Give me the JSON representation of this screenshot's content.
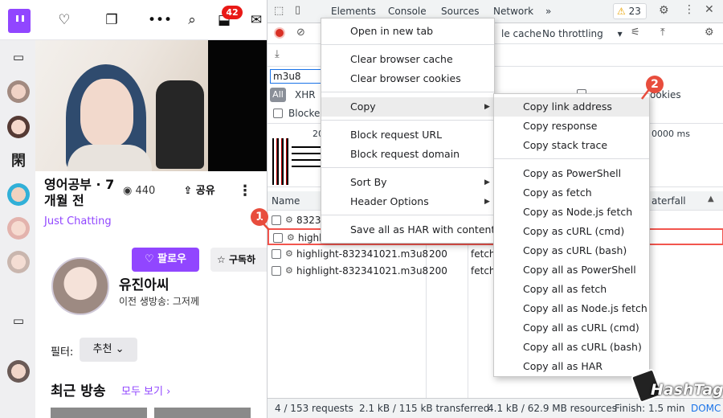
{
  "twitch": {
    "notification_count": "42",
    "stream_title": "영어공부 · 7개월 전",
    "viewers": "440",
    "share_label": "공유",
    "category": "Just Chatting",
    "follow_label": "팔로우",
    "subscribe_label": "구독하",
    "channel_name": "유진아씨",
    "last_stream": "이전 생방송: 그저께",
    "filter_label": "필터:",
    "filter_value": "추천",
    "recent_title": "최근 방송",
    "see_all": "모두 보기"
  },
  "devtools": {
    "tabs": [
      "Elements",
      "Console",
      "Sources",
      "Network"
    ],
    "warning_count": "23",
    "toolbar": {
      "disable_cache": "le cache",
      "throttling": "No throttling"
    },
    "filter_value": "m3u8",
    "types": {
      "all": "All",
      "xhr": "XHR"
    },
    "blocked_label": "Blocked",
    "cookies_label": "ookies",
    "timeline_ms": "0000 ms",
    "timeline_200": "20",
    "headers": {
      "name": "Name",
      "waterfall": "aterfall"
    },
    "rows": [
      {
        "name": "83234",
        "status": "",
        "type": ""
      },
      {
        "name": "highlig",
        "status": "",
        "type": ""
      },
      {
        "name": "highlight-832341021.m3u8",
        "status": "200",
        "type": "fetch"
      },
      {
        "name": "highlight-832341021.m3u8",
        "status": "200",
        "type": "fetch"
      }
    ],
    "status_bar": {
      "requests": "4 / 153 requests",
      "transferred": "2.1 kB / 115 kB transferred",
      "resources": "4.1 kB / 62.9 MB resources",
      "finish": "Finish: 1.5 min",
      "domc": "DOMC"
    }
  },
  "context_menu": {
    "items": [
      "Open in new tab",
      "Clear browser cache",
      "Clear browser cookies",
      "Copy",
      "Block request URL",
      "Block request domain",
      "Sort By",
      "Header Options",
      "Save all as HAR with content"
    ]
  },
  "copy_submenu": {
    "items": [
      "Copy link address",
      "Copy response",
      "Copy stack trace",
      "Copy as PowerShell",
      "Copy as fetch",
      "Copy as Node.js fetch",
      "Copy as cURL (cmd)",
      "Copy as cURL (bash)",
      "Copy all as PowerShell",
      "Copy all as fetch",
      "Copy all as Node.js fetch",
      "Copy all as cURL (cmd)",
      "Copy all as cURL (bash)",
      "Copy all as HAR"
    ]
  },
  "callouts": [
    "1",
    "2"
  ],
  "watermark": "HashTag",
  "colors": {
    "twitch_purple": "#9146ff",
    "devtools_blue": "#1a73e8",
    "callout_red": "#e84d3d"
  }
}
